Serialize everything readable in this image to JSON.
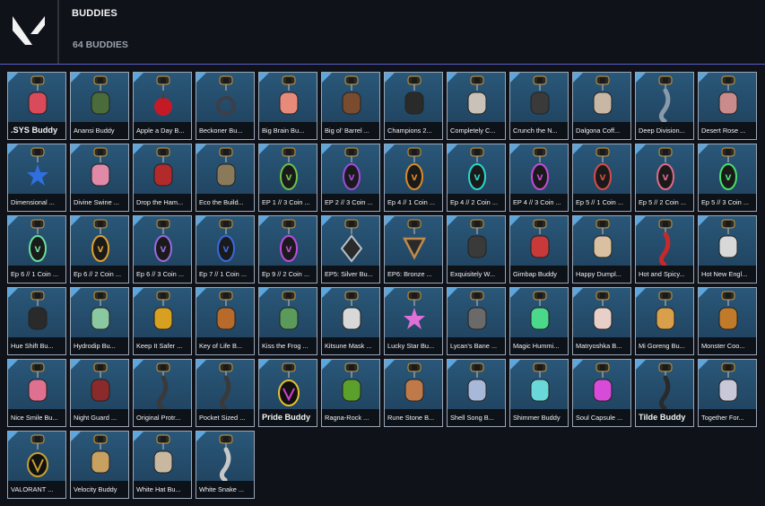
{
  "header": {
    "title": "BUDDIES",
    "count_label": "64 BUDDIES",
    "logo_icon": "valorant-logo-icon"
  },
  "colors": {
    "background": "#0f1219",
    "accent_rule": "#5a5fc7",
    "card_blue": "#234a68",
    "card_corner": "#5ca6dd",
    "label_bg": "#0d1118"
  },
  "buddies": [
    {
      "label": ".SYS Buddy",
      "color": "#d94a5a",
      "shape": "shield"
    },
    {
      "label": "Anansi Buddy",
      "color": "#4a6b3a",
      "shape": "bug"
    },
    {
      "label": "Apple a Day B...",
      "color": "#c41a28",
      "shape": "apple"
    },
    {
      "label": "Beckoner Bu...",
      "color": "#3c3f47",
      "shape": "ring"
    },
    {
      "label": "Big Brain Bu...",
      "color": "#e88a7a",
      "shape": "face"
    },
    {
      "label": "Big ol' Barrel ...",
      "color": "#7a4b2e",
      "shape": "barrel"
    },
    {
      "label": "Champions 2...",
      "color": "#2a2a2a",
      "shape": "cap"
    },
    {
      "label": "Completely C...",
      "color": "#c8c2b8",
      "shape": "helmet"
    },
    {
      "label": "Crunch the N...",
      "color": "#3a3a3a",
      "shape": "calc"
    },
    {
      "label": "Dalgona Coff...",
      "color": "#c9b7a5",
      "shape": "cup"
    },
    {
      "label": "Deep Division...",
      "color": "#8a9aa8",
      "shape": "sword"
    },
    {
      "label": "Desert Rose ...",
      "color": "#c98b8b",
      "shape": "pot"
    },
    {
      "label": "Dimensional ...",
      "color": "#2f6fe0",
      "shape": "star"
    },
    {
      "label": "Divine Swine ...",
      "color": "#e08aa8",
      "shape": "pig"
    },
    {
      "label": "Drop the Ham...",
      "color": "#b22a2a",
      "shape": "crab"
    },
    {
      "label": "Eco the Build...",
      "color": "#8a7a5a",
      "shape": "skull"
    },
    {
      "label": "EP 1 // 3 Coin ...",
      "color": "#6bc24a",
      "shape": "coin"
    },
    {
      "label": "EP 2 // 3 Coin ...",
      "color": "#a14adf",
      "shape": "coin"
    },
    {
      "label": "Ep 4 // 1 Coin ...",
      "color": "#d98a2a",
      "shape": "coin"
    },
    {
      "label": "Ep 4 // 2 Coin ...",
      "color": "#2ad9c8",
      "shape": "coin"
    },
    {
      "label": "EP 4 // 3 Coin ...",
      "color": "#c84ad9",
      "shape": "coin"
    },
    {
      "label": "Ep 5 // 1 Coin ...",
      "color": "#d94a4a",
      "shape": "coin"
    },
    {
      "label": "Ep 5 // 2 Coin ...",
      "color": "#e06a8a",
      "shape": "coin"
    },
    {
      "label": "Ep 5 // 3 Coin ...",
      "color": "#4adf6a",
      "shape": "coin"
    },
    {
      "label": "Ep 6 // 1 Coin ...",
      "color": "#6adf9a",
      "shape": "coin"
    },
    {
      "label": "Ep 6 // 2 Coin ...",
      "color": "#e0a02a",
      "shape": "coin"
    },
    {
      "label": "Ep 6 // 3 Coin ...",
      "color": "#9a6adf",
      "shape": "coin"
    },
    {
      "label": "Ep 7 // 1 Coin ...",
      "color": "#3a6adf",
      "shape": "coin"
    },
    {
      "label": "Ep 9 // 2 Coin ...",
      "color": "#c04adf",
      "shape": "coin"
    },
    {
      "label": "EP5: Silver Bu...",
      "color": "#b8c0c8",
      "shape": "diamond"
    },
    {
      "label": "EP6: Bronze ...",
      "color": "#c08a4a",
      "shape": "triangle"
    },
    {
      "label": "Exquisitely W...",
      "color": "#3a3a3a",
      "shape": "bag"
    },
    {
      "label": "Gimbap Buddy",
      "color": "#c83a3a",
      "shape": "roll"
    },
    {
      "label": "Happy Dumpl...",
      "color": "#d8c0a0",
      "shape": "dumpling"
    },
    {
      "label": "Hot and Spicy...",
      "color": "#c8282a",
      "shape": "pepper"
    },
    {
      "label": "Hot New Engl...",
      "color": "#d8d8d8",
      "shape": "rocket"
    },
    {
      "label": "Hue Shift Bu...",
      "color": "#2a2a2a",
      "shape": "record"
    },
    {
      "label": "Hydrodip Bu...",
      "color": "#8ac8a0",
      "shape": "shoe"
    },
    {
      "label": "Keep It Safer ...",
      "color": "#d8a020",
      "shape": "lock"
    },
    {
      "label": "Key of Life B...",
      "color": "#b86a2a",
      "shape": "ankh"
    },
    {
      "label": "Kiss the Frog ...",
      "color": "#5a9a5a",
      "shape": "frog"
    },
    {
      "label": "Kitsune Mask ...",
      "color": "#d8d8d8",
      "shape": "mask"
    },
    {
      "label": "Lucky Star Bu...",
      "color": "#e070d8",
      "shape": "star"
    },
    {
      "label": "Lycan's Bane ...",
      "color": "#6a6a6a",
      "shape": "wolf"
    },
    {
      "label": "Magic Hummi...",
      "color": "#4ad88a",
      "shape": "bird"
    },
    {
      "label": "Matryoshka B...",
      "color": "#e8d0c8",
      "shape": "doll"
    },
    {
      "label": "Mi Goreng Bu...",
      "color": "#d8a04a",
      "shape": "pack"
    },
    {
      "label": "Monster Coo...",
      "color": "#c07a2a",
      "shape": "cookie"
    },
    {
      "label": "Nice Smile Bu...",
      "color": "#e07090",
      "shape": "smile"
    },
    {
      "label": "Night Guard ...",
      "color": "#8a2a2a",
      "shape": "bat"
    },
    {
      "label": "Original Protr...",
      "color": "#3a3a3a",
      "shape": "claw"
    },
    {
      "label": "Pocket Sized ...",
      "color": "#3a3a3a",
      "shape": "knife"
    },
    {
      "label": "Pride Buddy",
      "color": "#e8c030",
      "shape": "pride"
    },
    {
      "label": "Ragna-Rock ...",
      "color": "#5aa02a",
      "shape": "drum"
    },
    {
      "label": "Rune Stone B...",
      "color": "#c07a4a",
      "shape": "stone"
    },
    {
      "label": "Shell Song B...",
      "color": "#a8b8d8",
      "shape": "shell"
    },
    {
      "label": "Shimmer Buddy",
      "color": "#6ad8d8",
      "shape": "bottle"
    },
    {
      "label": "Soul Capsule ...",
      "color": "#d84ad8",
      "shape": "crystal"
    },
    {
      "label": "Tilde Buddy",
      "color": "#2a2a2a",
      "shape": "tilde"
    },
    {
      "label": "Together For...",
      "color": "#c8c8d8",
      "shape": "chain"
    },
    {
      "label": "VALORANT ...",
      "color": "#c8a030",
      "shape": "vlogo"
    },
    {
      "label": "Velocity Buddy",
      "color": "#c8a060",
      "shape": "cup"
    },
    {
      "label": "White Hat Bu...",
      "color": "#c8b8a0",
      "shape": "hat"
    },
    {
      "label": "White Snake ...",
      "color": "#c8c8c8",
      "shape": "snake"
    }
  ],
  "big_labels": [
    ".SYS Buddy",
    "Pride Buddy",
    "Tilde Buddy"
  ]
}
